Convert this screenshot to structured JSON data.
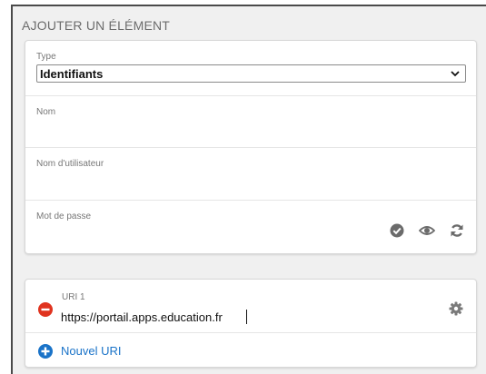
{
  "section": {
    "title": "AJOUTER UN ÉLÉMENT"
  },
  "type_field": {
    "label": "Type",
    "selected": "Identifiants"
  },
  "name_field": {
    "label": "Nom",
    "value": ""
  },
  "username_field": {
    "label": "Nom d'utilisateur",
    "value": ""
  },
  "password_field": {
    "label": "Mot de passe",
    "value": ""
  },
  "password_actions": {
    "check_icon": "check-circle-icon",
    "toggle_icon": "eye-icon",
    "generate_icon": "refresh-icon"
  },
  "uri": {
    "label": "URI 1",
    "value": "https://portail.apps.education.fr",
    "remove_icon": "minus-circle-icon",
    "settings_icon": "gear-icon"
  },
  "add_uri": {
    "label": "Nouvel URI",
    "icon": "plus-circle-icon"
  },
  "colors": {
    "accent": "#1a73c8",
    "remove": "#e0331f",
    "icon_gray": "#6b6b6b",
    "label_gray": "#777777"
  }
}
